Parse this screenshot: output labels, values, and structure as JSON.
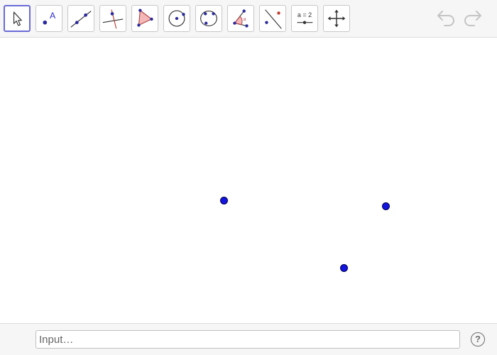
{
  "toolbar": {
    "tools": [
      {
        "name": "move-tool",
        "icon": "arrow-cursor-icon",
        "active": true
      },
      {
        "name": "point-tool",
        "icon": "point-icon",
        "label": "A"
      },
      {
        "name": "line-tool",
        "icon": "line-through-two-points-icon"
      },
      {
        "name": "perpendicular-line-tool",
        "icon": "perpendicular-line-icon"
      },
      {
        "name": "polygon-tool",
        "icon": "polygon-icon"
      },
      {
        "name": "circle-tool",
        "icon": "circle-center-point-icon"
      },
      {
        "name": "conic-tool",
        "icon": "circle-through-points-icon"
      },
      {
        "name": "angle-tool",
        "icon": "angle-icon"
      },
      {
        "name": "reflect-tool",
        "icon": "reflect-about-line-icon"
      },
      {
        "name": "slider-tool",
        "icon": "slider-icon",
        "label": "a = 2"
      },
      {
        "name": "move-graphics-view-tool",
        "icon": "move-arrows-icon"
      }
    ],
    "undo_icon": "undo-icon",
    "redo_icon": "redo-icon"
  },
  "colors": {
    "accent": "#6a6bd6",
    "point_fill": "#1414e0",
    "toolbar_bg": "#f6f6f6"
  },
  "input_bar": {
    "placeholder": "Input…",
    "help_label": "?"
  }
}
